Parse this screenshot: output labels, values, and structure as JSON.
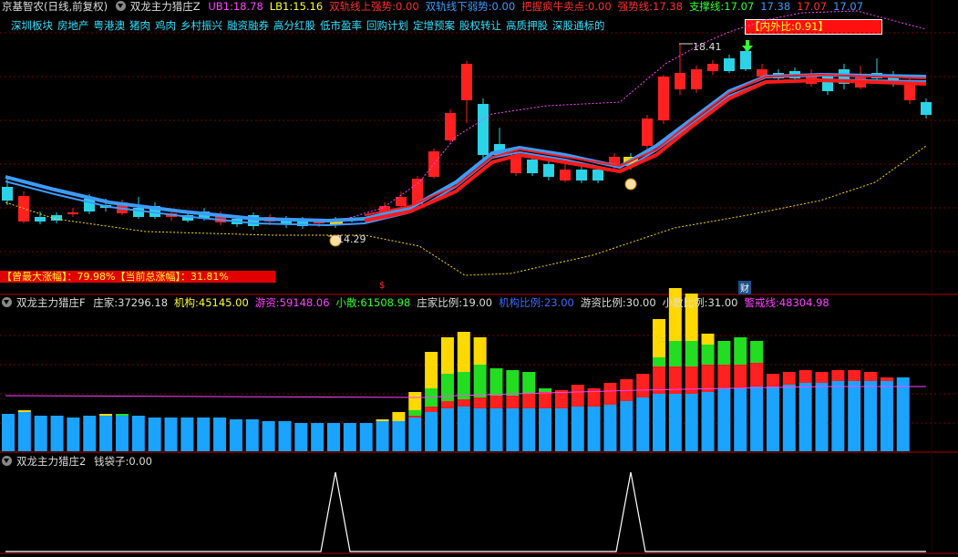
{
  "header": {
    "stock_name": "京基智农(日线,前复权)",
    "indicator": "双龙主力猎庄Z",
    "items": [
      {
        "label": "UB1:",
        "value": "18.78",
        "color": "#ff44ff"
      },
      {
        "label": "LB1:",
        "value": "15.16",
        "color": "#ffff33"
      },
      {
        "label": "双轨线上强势:",
        "value": "0.00",
        "color": "#ff3030"
      },
      {
        "label": "双轨线下弱势:",
        "value": "0.00",
        "color": "#3c9cff"
      },
      {
        "label": "把握疯牛卖点:",
        "value": "0.00",
        "color": "#ff3030"
      },
      {
        "label": "强势线:",
        "value": "17.38",
        "color": "#ff3030"
      },
      {
        "label": "支撑线:",
        "value": "17.07",
        "color": "#33ff33"
      },
      {
        "label": "",
        "value": "17.38",
        "color": "#3c9cff"
      },
      {
        "label": "",
        "value": "17.07",
        "color": "#ff3030"
      },
      {
        "label": "",
        "value": "17.07",
        "color": "#3c9cff"
      }
    ]
  },
  "sectors": [
    "深圳板块",
    "房地产",
    "粤港澳",
    "猪肉",
    "鸡肉",
    "乡村振兴",
    "融资融券",
    "高分红股",
    "低市盈率",
    "回购计划",
    "定增预案",
    "股权转让",
    "高质押股",
    "深股通标的"
  ],
  "inner_outer": {
    "label": "【内外比:",
    "value": "0.91",
    "suffix": "】"
  },
  "price_labels": {
    "high": "18.41",
    "low": "14.29"
  },
  "markers": {
    "money_bag": "$",
    "cai": "财"
  },
  "range_box": {
    "text": "【曾最大涨幅】：79.98%【当前总涨幅】：31.81%"
  },
  "panel2": {
    "indicator": "双龙主力猎庄F",
    "items": [
      {
        "label": "庄家:",
        "value": "37296.18",
        "color": "#dddddd"
      },
      {
        "label": "机构:",
        "value": "45145.00",
        "color": "#ffff33"
      },
      {
        "label": "游资:",
        "value": "59148.06",
        "color": "#ff44ff"
      },
      {
        "label": "小散:",
        "value": "61508.98",
        "color": "#33ff33"
      },
      {
        "label": "庄家比例:",
        "value": "19.00",
        "color": "#dddddd"
      },
      {
        "label": "机构比例:",
        "value": "23.00",
        "color": "#3c6cff"
      },
      {
        "label": "游资比例:",
        "value": "30.00",
        "color": "#dddddd"
      },
      {
        "label": "小散比例:",
        "value": "31.00",
        "color": "#dddddd"
      },
      {
        "label": "警戒线:",
        "value": "48304.98",
        "color": "#ff44ff"
      }
    ]
  },
  "panel3": {
    "indicator": "双龙主力猎庄2",
    "items": [
      {
        "label": "钱袋子:",
        "value": "0.00",
        "color": "#dddddd"
      }
    ]
  },
  "colors": {
    "up": "#ff2020",
    "down": "#2bd3e6",
    "bar_blue": "#1aa3ff",
    "bar_red": "#ff2020",
    "bar_green": "#22dd22",
    "bar_yellow": "#ffd800",
    "grid": "#7a0000"
  }
}
